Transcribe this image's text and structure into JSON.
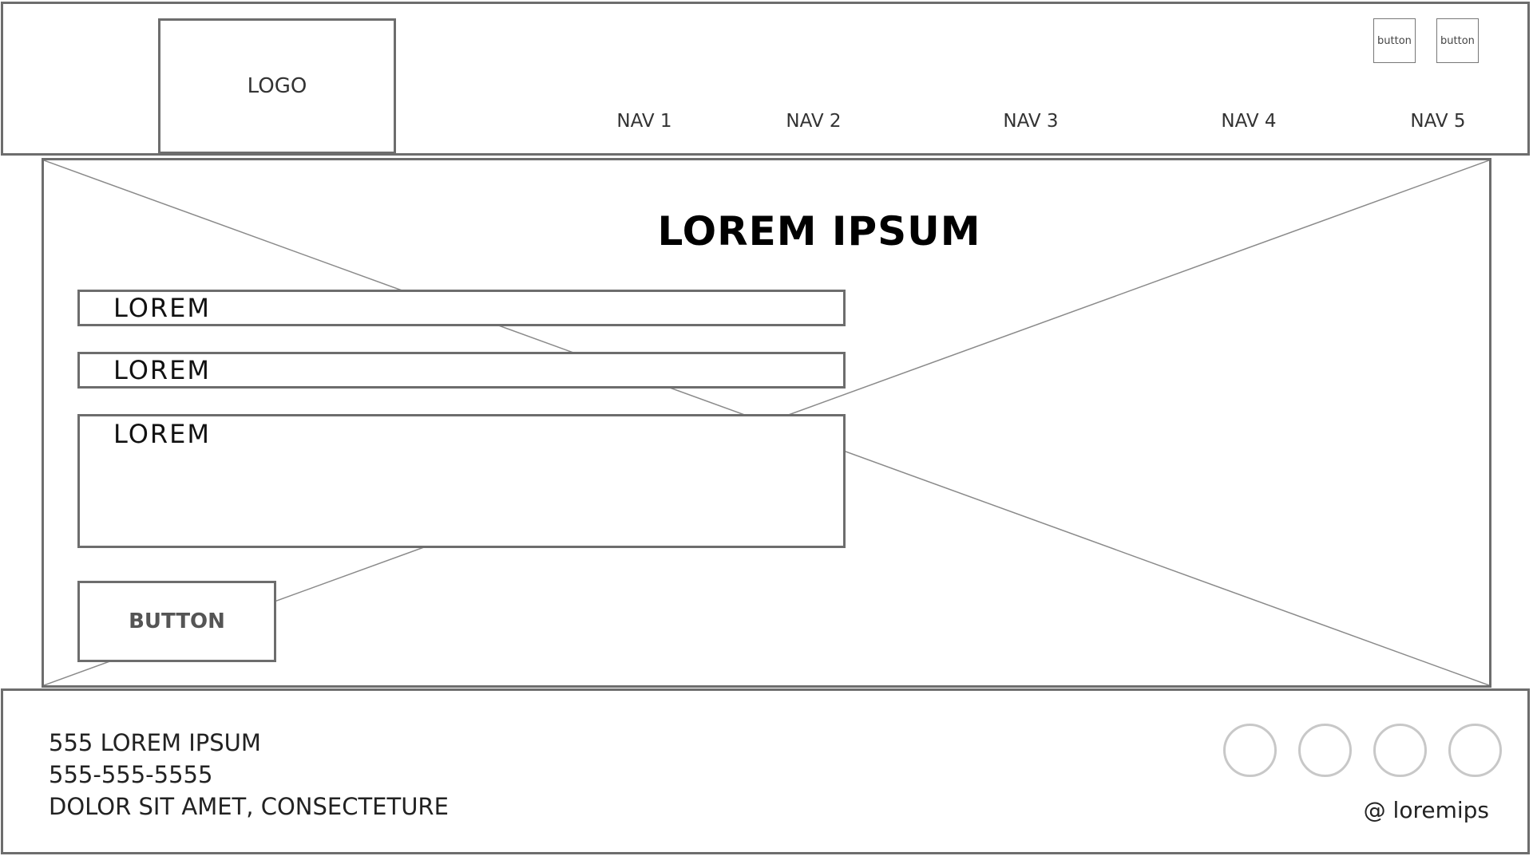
{
  "header": {
    "logo_text": "LOGO",
    "nav": [
      "NAV 1",
      "NAV 2",
      "NAV 3",
      "NAV 4",
      "NAV 5"
    ],
    "buttons": [
      "button",
      "button"
    ]
  },
  "hero": {
    "title": "LOREM IPSUM",
    "fields": [
      "LOREM",
      "LOREM",
      "LOREM"
    ],
    "submit_label": "BUTTON"
  },
  "footer": {
    "address_lines": [
      "555 LOREM IPSUM",
      "555-555-5555",
      "DOLOR SIT AMET, CONSECTETURE"
    ],
    "handle": "@ loremips"
  },
  "colors": {
    "border": "#6d6d6d",
    "social_circle": "#c8c8c8",
    "placeholder_line": "#8a8a8a"
  }
}
